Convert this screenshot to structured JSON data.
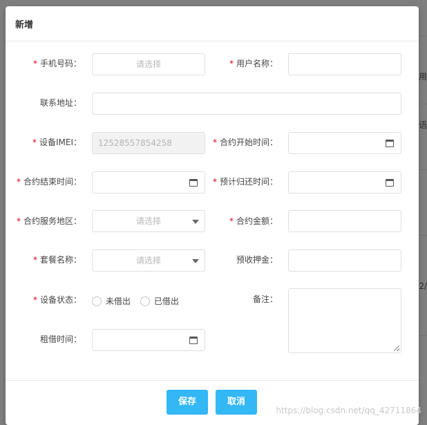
{
  "dialog": {
    "title": "新增"
  },
  "fields": {
    "phone": {
      "label": "手机号码：",
      "placeholder": "请选择"
    },
    "username": {
      "label": "用户名称："
    },
    "address": {
      "label": "联系地址："
    },
    "imei": {
      "label": "设备IMEI：",
      "value": "12528557854258"
    },
    "contract_start": {
      "label": "合约开始时间："
    },
    "contract_end": {
      "label": "合约结束时间："
    },
    "return_time": {
      "label": "预计归还时间："
    },
    "service_area": {
      "label": "合约服务地区：",
      "placeholder": "请选择"
    },
    "contract_amount": {
      "label": "合约金额："
    },
    "package": {
      "label": "套餐名称：",
      "placeholder": "请选择"
    },
    "deposit": {
      "label": "预收押金："
    },
    "device_status": {
      "label": "设备状态：",
      "options": [
        "未借出",
        "已借出"
      ]
    },
    "remark": {
      "label": "备注："
    },
    "rent_time": {
      "label": "租借时间："
    }
  },
  "buttons": {
    "save": "保存",
    "cancel": "取消"
  },
  "background": {
    "fragments": [
      "用",
      "语",
      "2/"
    ]
  },
  "watermark": "https://blog.csdn.net/qq_42711864",
  "colors": {
    "primary": "#33b7f5",
    "required": "#d9001b"
  }
}
